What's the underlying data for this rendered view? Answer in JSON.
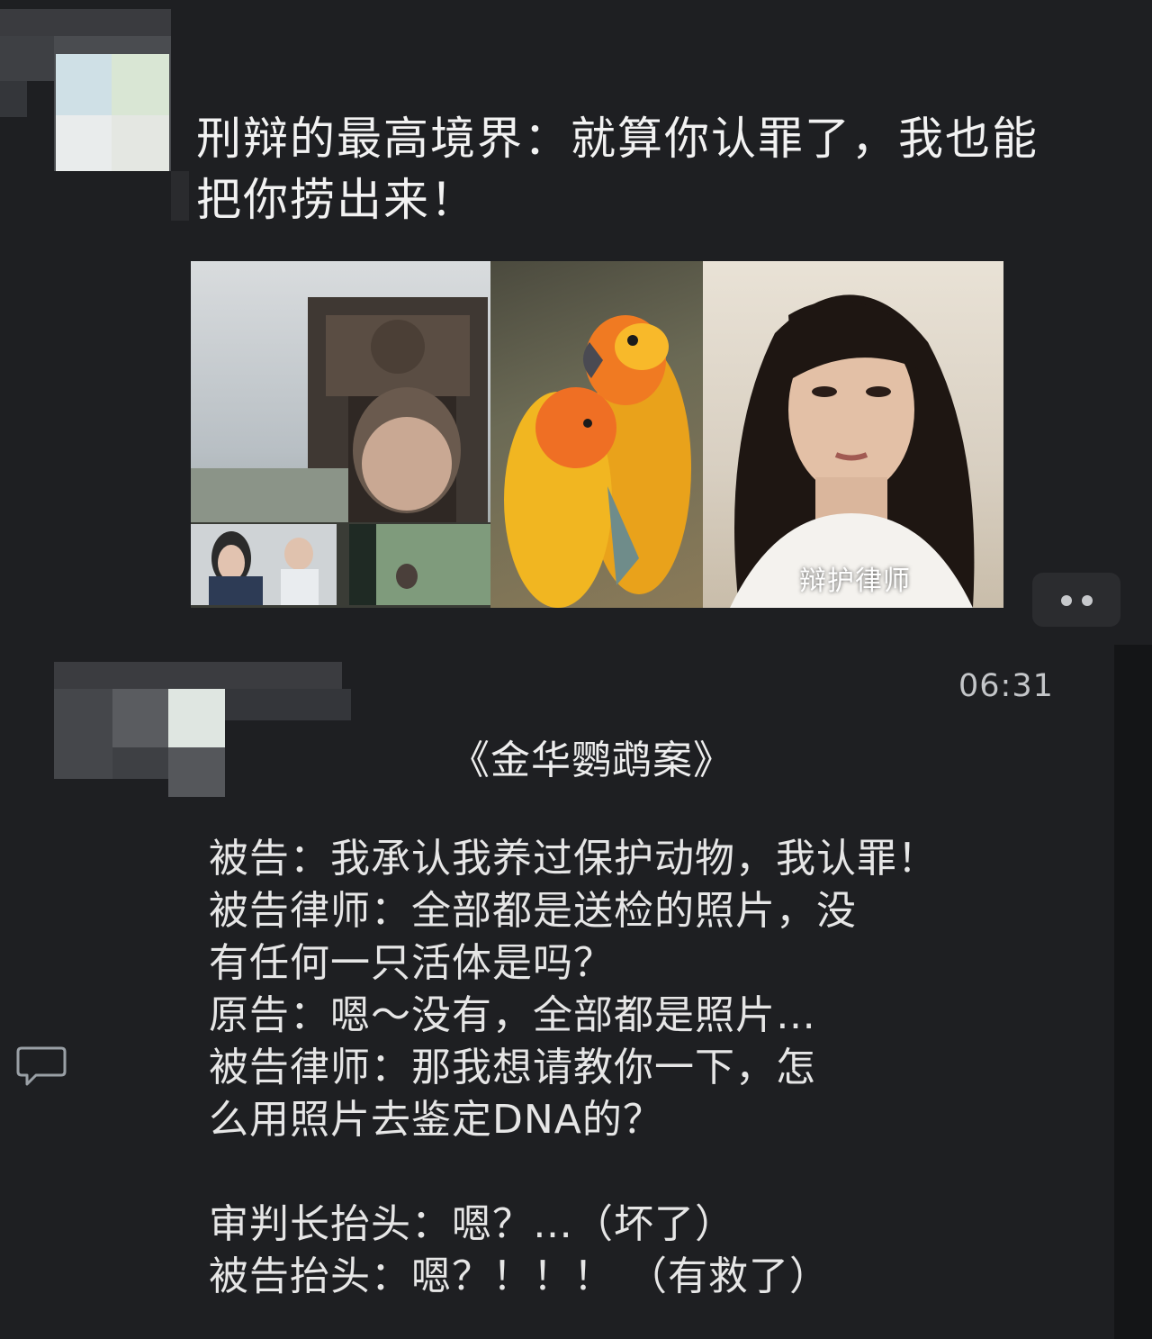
{
  "post": {
    "title_lines": [
      "刑辩的最高境界：就算你认罪了，我也能",
      "把你捞出来！"
    ],
    "images": [
      {
        "icon": "courtroom-video-screenshot-image"
      },
      {
        "icon": "sun-conure-parrots-image"
      },
      {
        "icon": "defense-lawyer-portrait-image",
        "caption": "辩护律师"
      }
    ]
  },
  "comment": {
    "timestamp": "06:31",
    "book_title": "《金华鹦鹉案》",
    "lines": [
      "被告：我承认我养过保护动物，我认罪！",
      "被告律师：全部都是送检的照片，没",
      "有任何一只活体是吗？",
      "原告：嗯～没有，全部都是照片…",
      "被告律师：那我想请教你一下，怎",
      "么用照片去鉴定DNA的？",
      "",
      "审判长抬头：嗯？…（坏了）",
      "被告抬头：嗯？！！！  （有救了）"
    ]
  },
  "colors": {
    "background": "#1e1f22",
    "text": "#e6e6e6",
    "timestamp": "#c4c6c9",
    "caption": "#ffffff"
  },
  "icons": {
    "more": "more-dots-icon",
    "comment": "comment-bubble-icon",
    "avatar": "pixelated-avatar-icon"
  }
}
